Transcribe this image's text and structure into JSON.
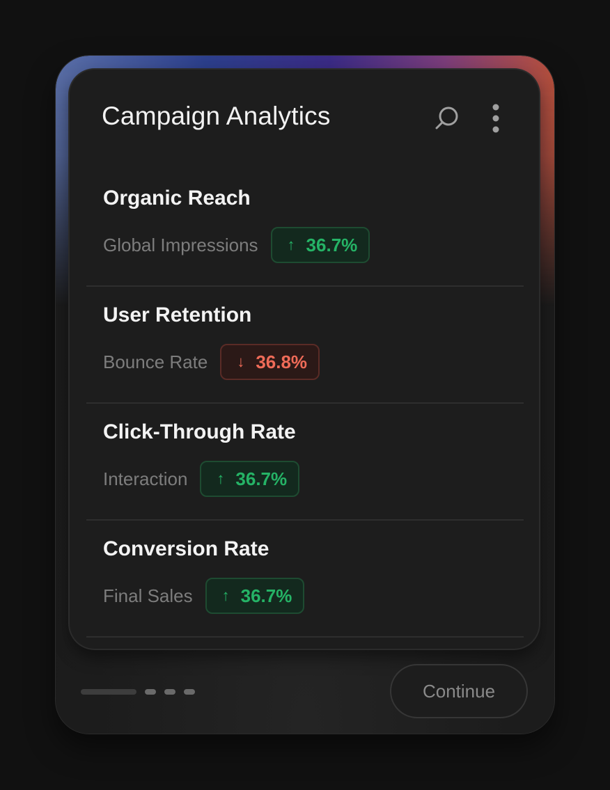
{
  "header": {
    "title": "Campaign Analytics",
    "search_icon": "search-icon",
    "more_icon": "more-vertical-icon"
  },
  "metrics": [
    {
      "title": "Organic Reach",
      "subtitle": "Global Impressions",
      "trend": "up",
      "arrow": "↑",
      "value": "36.7%"
    },
    {
      "title": "User Retention",
      "subtitle": "Bounce Rate",
      "trend": "down",
      "arrow": "↓",
      "value": "36.8%"
    },
    {
      "title": "Click-Through Rate",
      "subtitle": "Interaction",
      "trend": "up",
      "arrow": "↑",
      "value": "36.7%"
    },
    {
      "title": "Conversion Rate",
      "subtitle": "Final Sales",
      "trend": "up",
      "arrow": "↑",
      "value": "36.7%"
    }
  ],
  "footer": {
    "continue_label": "Continue",
    "pager": {
      "total": 4,
      "active_index": 0
    }
  },
  "colors": {
    "up": "#25b366",
    "down": "#ef6b58",
    "background": "#111111",
    "rim_gradient": [
      "#5a6fa8",
      "#2c3f8c",
      "#3a2b86",
      "#7b3d7a",
      "#b7503c"
    ]
  }
}
